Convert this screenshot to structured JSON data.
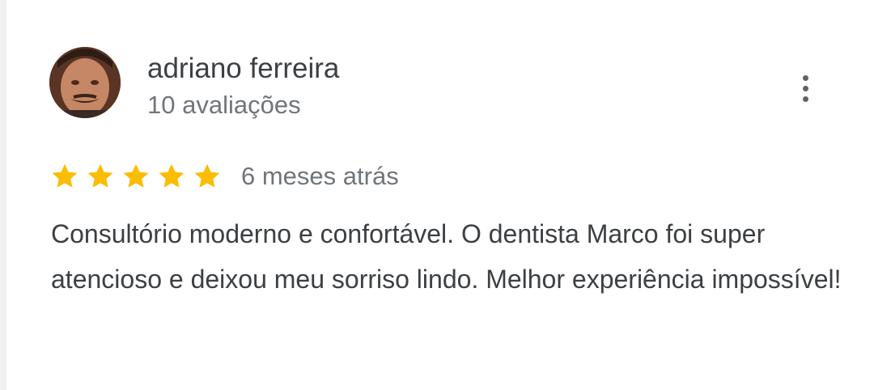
{
  "review": {
    "author_name": "adriano ferreira",
    "review_count": "10 avaliações",
    "rating": 5,
    "max_rating": 5,
    "time_ago": "6 meses atrás",
    "text": "Consultório moderno e confortável. O dentista Marco foi super atencioso e deixou meu sorriso lindo. Melhor experiência impossível!"
  },
  "icons": {
    "avatar": "user-photo",
    "star": "star-icon",
    "more": "more-vertical-icon"
  },
  "colors": {
    "star_fill": "#fbbc04",
    "name_text": "#3c4043",
    "secondary_text": "#70757a",
    "body_text": "#3c4043",
    "icon_gray": "#5f6368"
  }
}
